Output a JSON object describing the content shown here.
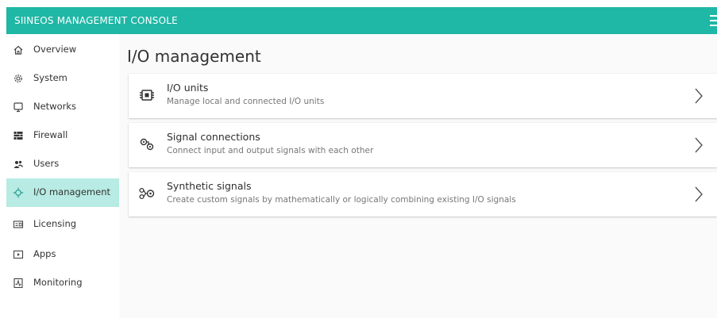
{
  "header": {
    "app_title": "SIINEOS MANAGEMENT CONSOLE",
    "menu_icon": "hamburger-menu-icon",
    "accent_color": "#1fb7a6"
  },
  "sidebar": {
    "active_background": "#b7ebe3",
    "items": [
      {
        "label": "Overview",
        "icon": "home-icon"
      },
      {
        "label": "System",
        "icon": "gear-icon"
      },
      {
        "label": "Networks",
        "icon": "monitor-icon"
      },
      {
        "label": "Firewall",
        "icon": "firewall-icon"
      },
      {
        "label": "Users",
        "icon": "users-icon"
      },
      {
        "label": "I/O management",
        "icon": "io-management-icon",
        "active": true
      },
      {
        "label": "Licensing",
        "icon": "license-icon"
      },
      {
        "label": "Apps",
        "icon": "apps-icon"
      },
      {
        "label": "Monitoring",
        "icon": "monitoring-icon"
      }
    ]
  },
  "main": {
    "title": "I/O management",
    "cards": [
      {
        "title": "I/O units",
        "description": "Manage local and connected I/O units",
        "icon": "io-unit-icon"
      },
      {
        "title": "Signal connections",
        "description": "Connect input and output signals with each other",
        "icon": "signal-connection-icon"
      },
      {
        "title": "Synthetic signals",
        "description": "Create custom signals by mathematically or logically combining existing I/O signals",
        "icon": "synthetic-signal-icon"
      }
    ],
    "chevron_icon": "chevron-right-icon"
  }
}
